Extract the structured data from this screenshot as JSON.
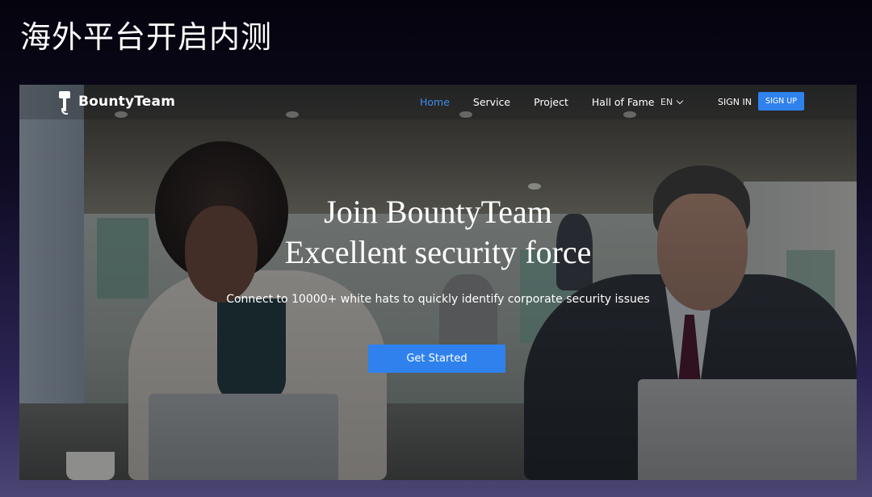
{
  "slide": {
    "title": "海外平台开启内测"
  },
  "site": {
    "brand": {
      "name": "BountyTeam",
      "logo_icon": "hammer-icon"
    },
    "nav": {
      "items": [
        {
          "label": "Home",
          "active": true
        },
        {
          "label": "Service",
          "active": false
        },
        {
          "label": "Project",
          "active": false
        },
        {
          "label": "Hall of Fame",
          "active": false
        }
      ],
      "language": {
        "label": "EN",
        "icon": "chevron-down-icon"
      },
      "sign_in": "SIGN IN",
      "sign_up": "SIGN UP"
    },
    "hero": {
      "title_line1": "Join BountyTeam",
      "title_line2": "Excellent security force",
      "subtitle": "Connect to 10000+ white hats to quickly identify corporate security issues",
      "cta": "Get Started"
    },
    "colors": {
      "accent": "#2f82ee",
      "active_nav": "#3e8df0"
    }
  }
}
